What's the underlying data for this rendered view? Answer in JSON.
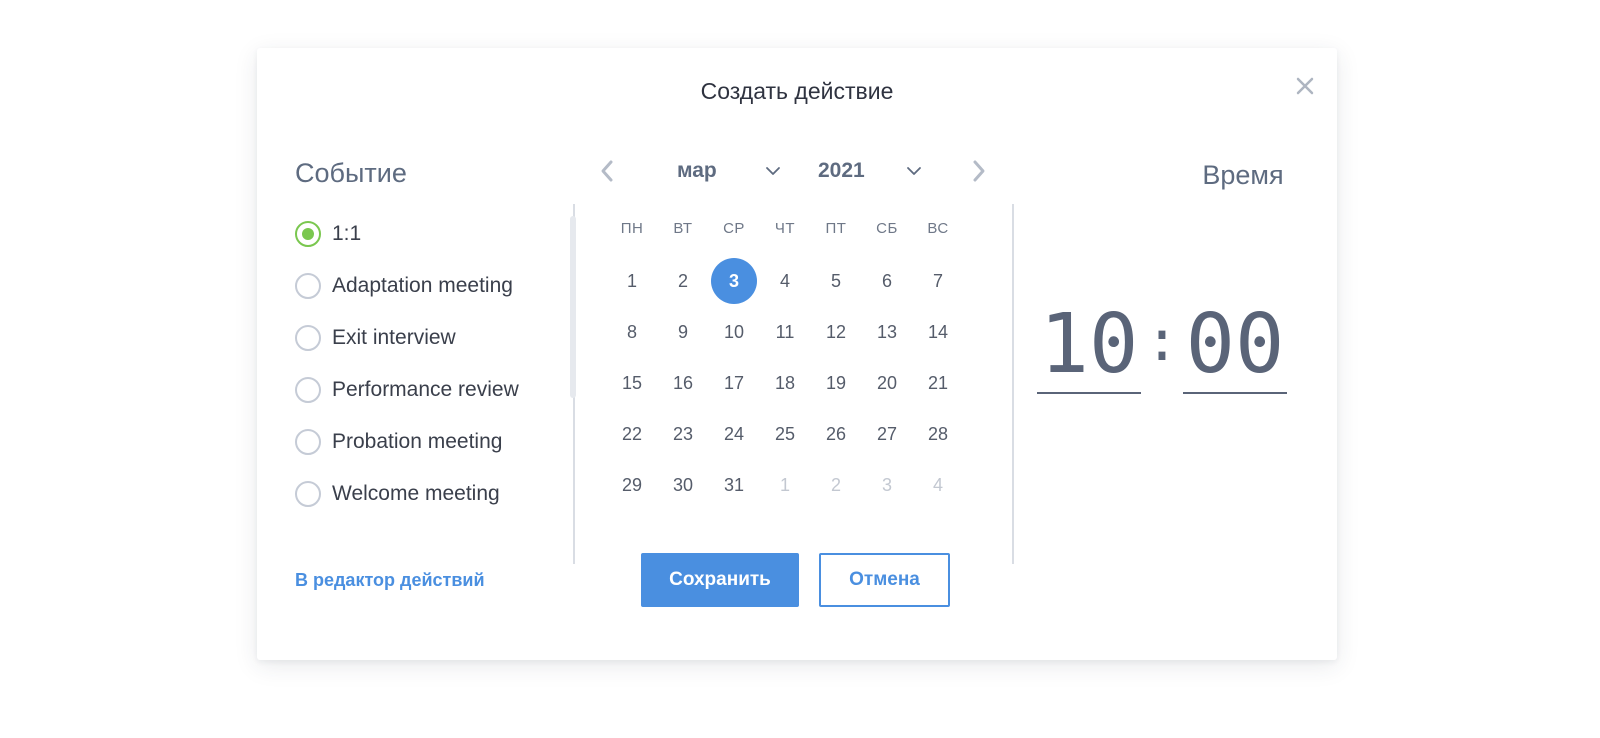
{
  "dialog": {
    "title": "Создать действие"
  },
  "event": {
    "title": "Событие",
    "options": [
      {
        "label": "1:1",
        "checked": true
      },
      {
        "label": "Adaptation meeting",
        "checked": false
      },
      {
        "label": "Exit interview",
        "checked": false
      },
      {
        "label": "Performance review",
        "checked": false
      },
      {
        "label": "Probation meeting",
        "checked": false
      },
      {
        "label": "Welcome meeting",
        "checked": false
      }
    ]
  },
  "calendar": {
    "month": "мар",
    "year": "2021",
    "weekdays": [
      "ПН",
      "ВТ",
      "СР",
      "ЧТ",
      "ПТ",
      "СБ",
      "ВС"
    ],
    "days": [
      {
        "label": "1",
        "muted": false
      },
      {
        "label": "2",
        "muted": false
      },
      {
        "label": "3",
        "muted": false,
        "selected": true
      },
      {
        "label": "4",
        "muted": false
      },
      {
        "label": "5",
        "muted": false
      },
      {
        "label": "6",
        "muted": false
      },
      {
        "label": "7",
        "muted": false
      },
      {
        "label": "8",
        "muted": false
      },
      {
        "label": "9",
        "muted": false
      },
      {
        "label": "10",
        "muted": false
      },
      {
        "label": "11",
        "muted": false
      },
      {
        "label": "12",
        "muted": false
      },
      {
        "label": "13",
        "muted": false
      },
      {
        "label": "14",
        "muted": false
      },
      {
        "label": "15",
        "muted": false
      },
      {
        "label": "16",
        "muted": false
      },
      {
        "label": "17",
        "muted": false
      },
      {
        "label": "18",
        "muted": false
      },
      {
        "label": "19",
        "muted": false
      },
      {
        "label": "20",
        "muted": false
      },
      {
        "label": "21",
        "muted": false
      },
      {
        "label": "22",
        "muted": false
      },
      {
        "label": "23",
        "muted": false
      },
      {
        "label": "24",
        "muted": false
      },
      {
        "label": "25",
        "muted": false
      },
      {
        "label": "26",
        "muted": false
      },
      {
        "label": "27",
        "muted": false
      },
      {
        "label": "28",
        "muted": false
      },
      {
        "label": "29",
        "muted": false
      },
      {
        "label": "30",
        "muted": false
      },
      {
        "label": "31",
        "muted": false
      },
      {
        "label": "1",
        "muted": true
      },
      {
        "label": "2",
        "muted": true
      },
      {
        "label": "3",
        "muted": true
      },
      {
        "label": "4",
        "muted": true
      }
    ]
  },
  "time": {
    "title": "Время",
    "hours": "10",
    "separator": ":",
    "minutes": "00"
  },
  "footer": {
    "editor_link": "В редактор действий",
    "save_label": "Сохранить",
    "cancel_label": "Отмена"
  },
  "colors": {
    "accent": "#4a8fe0",
    "radio_selected": "#7ac74f",
    "text_muted": "#5e6b80"
  },
  "icons": {
    "close": "close-icon",
    "prev": "chevron-left-icon",
    "next": "chevron-right-icon",
    "dropdown": "chevron-down-icon"
  }
}
